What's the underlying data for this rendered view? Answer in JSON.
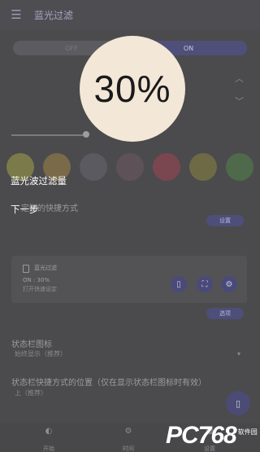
{
  "header": {
    "title": "蓝光过滤"
  },
  "toggle": {
    "off_label": "OFF",
    "on_label": "ON"
  },
  "filter": {
    "opacity_value": "30%",
    "opacity_fraction": 0.3
  },
  "swatches": [
    {
      "name": "orange",
      "color": "#7a7a4a"
    },
    {
      "name": "amber",
      "color": "#7a6a4a"
    },
    {
      "name": "gray",
      "color": "#5a5a60"
    },
    {
      "name": "mauve",
      "color": "#5e5258"
    },
    {
      "name": "red",
      "color": "#7a4650"
    },
    {
      "name": "yellow",
      "color": "#6e6a46"
    },
    {
      "name": "green",
      "color": "#4e6a4a"
    }
  ],
  "tutorial": {
    "heading": "蓝光波过滤量",
    "next": "下一步"
  },
  "shortcut": {
    "label": "定制的快捷方式",
    "set_button": "设置"
  },
  "card": {
    "title": "蓝光过滤",
    "status": "ON : 30%",
    "hint": "打开快速设定",
    "settings_button": "选项"
  },
  "status_icon": {
    "label": "状态栏图标",
    "value": "始终显示（推荐）"
  },
  "status_position": {
    "label": "状态栏快捷方式的位置（仅在显示状态栏图标时有效）",
    "value": "上（推荐）"
  },
  "bottom_nav": {
    "items": [
      {
        "label": "开始"
      },
      {
        "label": "时间"
      },
      {
        "label": "设置"
      }
    ]
  },
  "watermark": {
    "brand": "PC768",
    "sub": "软件园"
  },
  "colors": {
    "accent": "#4f4f79",
    "spotlight": "#f3e7d8"
  }
}
